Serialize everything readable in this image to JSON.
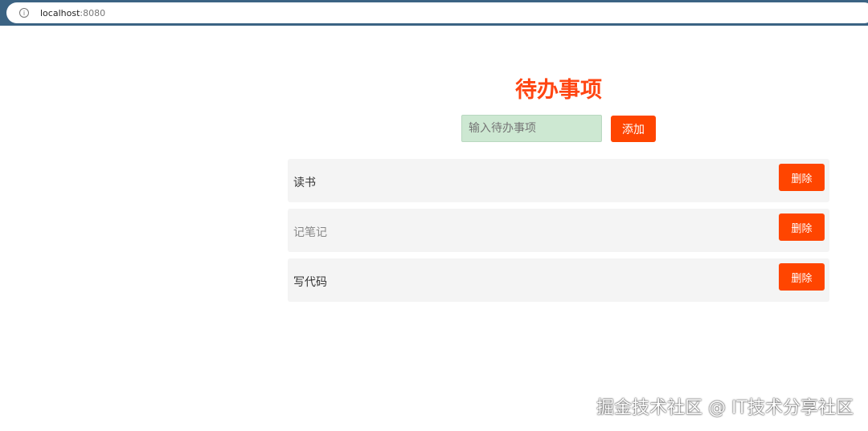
{
  "browser": {
    "url_host": "localhost",
    "url_port": ":8080"
  },
  "title": "待办事项",
  "input": {
    "placeholder": "输入待办事项",
    "value": ""
  },
  "add_label": "添加",
  "todos": [
    {
      "text": "读书",
      "delete_label": "删除",
      "done": false
    },
    {
      "text": "记笔记",
      "delete_label": "删除",
      "done": true
    },
    {
      "text": "写代码",
      "delete_label": "删除",
      "done": false
    }
  ],
  "watermark": "掘金技术社区 @ IT技术分享社区",
  "colors": {
    "accent": "#ff4500",
    "input_bg": "#cde8d2",
    "item_bg": "#f4f4f4"
  }
}
